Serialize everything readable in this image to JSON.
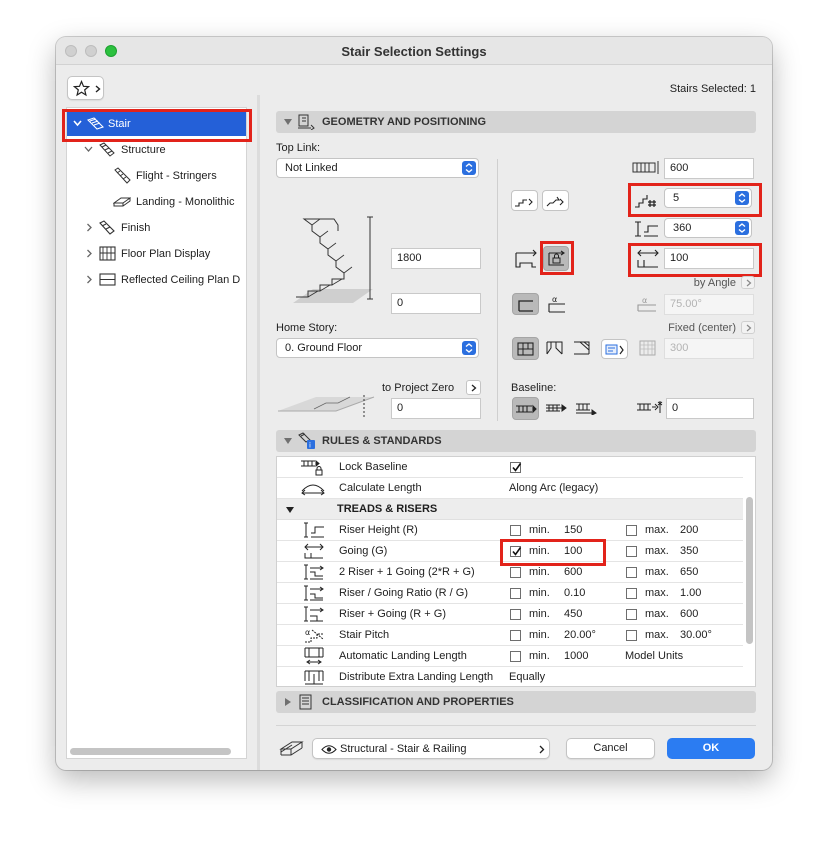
{
  "window": {
    "title": "Stair Selection Settings",
    "selection_count": "Stairs Selected: 1"
  },
  "tree": [
    {
      "label": "Stair",
      "selected": true
    },
    {
      "label": "Structure"
    },
    {
      "label": "Flight - Stringers"
    },
    {
      "label": "Landing - Monolithic"
    },
    {
      "label": "Finish"
    },
    {
      "label": "Floor Plan Display"
    },
    {
      "label": "Reflected Ceiling Plan D"
    }
  ],
  "geometry": {
    "title": "GEOMETRY AND POSITIONING",
    "top_link_label": "Top Link:",
    "top_link_value": "Not Linked",
    "height_value": "1800",
    "bottom_offset_value": "0",
    "home_story_label": "Home Story:",
    "home_story_value": "0. Ground Floor",
    "to_project_zero_label": "to Project Zero",
    "project_zero_value": "0",
    "width_value": "600",
    "riser_count_value": "5",
    "riser_height_value": "360",
    "going_value": "100",
    "by_angle_label": "by Angle",
    "angle_value": "75.00°",
    "fixed_center_label": "Fixed (center)",
    "fixed_value": "300",
    "baseline_label": "Baseline:",
    "baseline_offset_value": "0"
  },
  "rules": {
    "title": "RULES & STANDARDS",
    "lock_baseline_label": "Lock Baseline",
    "calc_length_label": "Calculate Length",
    "calc_length_value": "Along Arc (legacy)",
    "treads_title": "TREADS & RISERS",
    "min_label": "min.",
    "max_label": "max.",
    "rows": [
      {
        "label": "Riser Height (R)",
        "min_checked": false,
        "min": "150",
        "max_checked": false,
        "max": "200"
      },
      {
        "label": "Going (G)",
        "min_checked": true,
        "min": "100",
        "max_checked": false,
        "max": "350"
      },
      {
        "label": "2 Riser + 1 Going (2*R + G)",
        "min_checked": false,
        "min": "600",
        "max_checked": false,
        "max": "650"
      },
      {
        "label": "Riser / Going Ratio (R / G)",
        "min_checked": false,
        "min": "0.10",
        "max_checked": false,
        "max": "1.00"
      },
      {
        "label": "Riser + Going (R + G)",
        "min_checked": false,
        "min": "450",
        "max_checked": false,
        "max": "600"
      },
      {
        "label": "Stair Pitch",
        "min_checked": false,
        "min": "20.00°",
        "max_checked": false,
        "max": "30.00°"
      }
    ],
    "auto_landing_label": "Automatic Landing Length",
    "auto_landing_min": "1000",
    "auto_landing_extra": "Model Units",
    "distribute_label": "Distribute Extra Landing Length",
    "distribute_value": "Equally"
  },
  "classification": {
    "title": "CLASSIFICATION AND PROPERTIES"
  },
  "footer": {
    "favorite": "Structural - Stair & Railing",
    "cancel": "Cancel",
    "ok": "OK"
  },
  "colors": {
    "accent": "#2b6fdf",
    "highlight": "#e2231a",
    "selection": "#2460d8"
  }
}
